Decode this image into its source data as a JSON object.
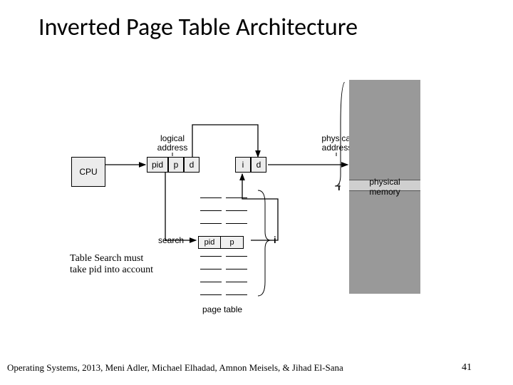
{
  "title": "Inverted Page Table Architecture",
  "labels": {
    "cpu": "CPU",
    "logical_address": "logical\naddress",
    "physical_address": "physical\naddress",
    "pid": "pid",
    "p": "p",
    "d": "d",
    "i": "i",
    "search": "search",
    "page_table": "page table",
    "physical_memory": "physical\nmemory",
    "i_brace": "i"
  },
  "note": {
    "line1": "Table Search must",
    "line2": "take pid into account"
  },
  "footer": "Operating Systems, 2013, Meni Adler, Michael Elhadad, Amnon Meisels, & Jihad El-Sana",
  "page_number": "41"
}
